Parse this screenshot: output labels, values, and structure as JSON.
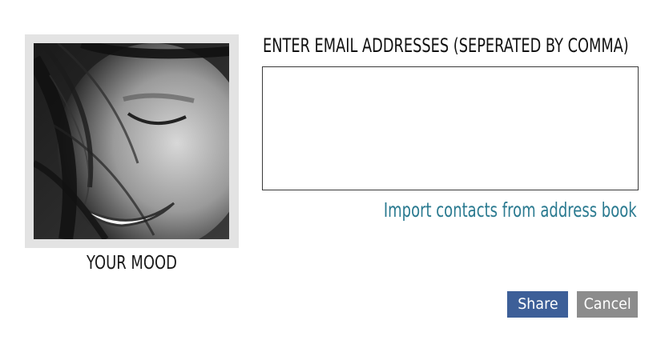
{
  "email_section": {
    "heading": "ENTER EMAIL ADDRESSES (SEPERATED BY COMMA)",
    "textarea_value": "",
    "import_link": "Import contacts from address book"
  },
  "mood": {
    "label": "YOUR MOOD",
    "image_icon": "portrait-photo"
  },
  "actions": {
    "share_label": "Share",
    "cancel_label": "Cancel"
  },
  "colors": {
    "share_button": "#3d5f98",
    "cancel_button": "#8c8c8c",
    "link": "#2a7a90",
    "frame": "#e3e3e3"
  }
}
